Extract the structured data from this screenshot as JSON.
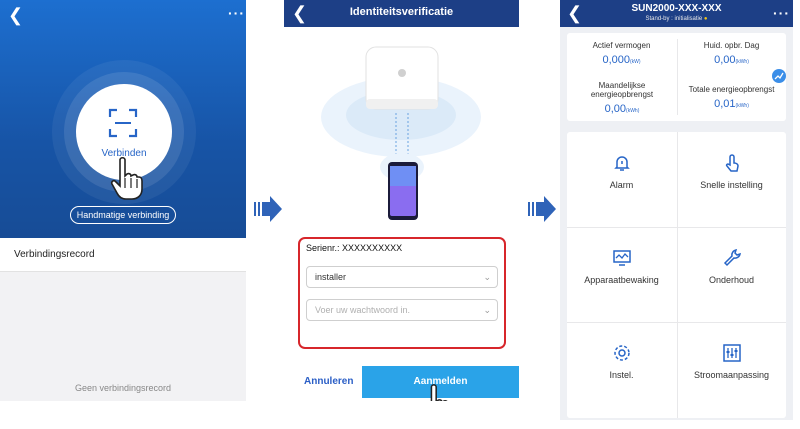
{
  "screen1": {
    "connect_label": "Verbinden",
    "manual_button": "Handmatige verbinding",
    "record_title": "Verbindingsrecord",
    "no_record": "Geen verbindingsrecord"
  },
  "screen2": {
    "title": "Identiteitsverificatie",
    "serial_label": "Serienr.:",
    "serial_value": "XXXXXXXXXX",
    "user_value": "installer",
    "password_placeholder": "Voer uw wachtwoord in.",
    "cancel_label": "Annuleren",
    "login_label": "Aanmelden"
  },
  "screen3": {
    "title": "SUN2000-XXX-XXX",
    "status": "Stand-by : initialisatie",
    "stats": [
      {
        "label": "Actief vermogen",
        "value": "0,000",
        "unit": "(kW)"
      },
      {
        "label": "Huid. opbr. Dag",
        "value": "0,00",
        "unit": "(kWh)"
      },
      {
        "label": "Maandelijkse energieopbrengst",
        "value": "0,00",
        "unit": "(kWh)"
      },
      {
        "label": "Totale energieopbrengst",
        "value": "0,01",
        "unit": "(kWh)"
      }
    ],
    "tiles": [
      {
        "label": "Alarm",
        "icon": "bell-icon"
      },
      {
        "label": "Snelle instelling",
        "icon": "tap-icon"
      },
      {
        "label": "Apparaatbewaking",
        "icon": "monitor-icon"
      },
      {
        "label": "Onderhoud",
        "icon": "wrench-icon"
      },
      {
        "label": "Instel.",
        "icon": "gear-icon"
      },
      {
        "label": "Stroomaanpassing",
        "icon": "sliders-icon"
      }
    ]
  },
  "colors": {
    "header_blue": "#1d3f86",
    "hero_blue": "#1d6fd0",
    "accent_blue": "#2765c7",
    "login_blue": "#2aa3e8",
    "highlight_red": "#d7262b"
  }
}
